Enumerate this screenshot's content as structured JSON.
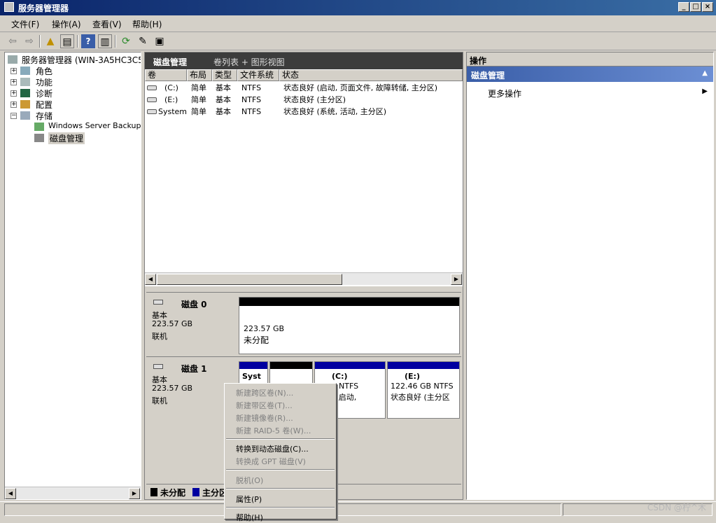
{
  "window": {
    "title": "服务器管理器"
  },
  "menu": [
    "文件(F)",
    "操作(A)",
    "查看(V)",
    "帮助(H)"
  ],
  "toolbar": {
    "icons": [
      "back-icon",
      "forward-icon",
      "up-folder-icon",
      "show-hide-tree-icon",
      "help-icon",
      "properties-icon",
      "refresh-icon",
      "export-icon",
      "rescan-icon"
    ]
  },
  "tree": {
    "root": "服务器管理器 (WIN-3A5HC3C504",
    "items": [
      "角色",
      "功能",
      "诊断",
      "配置",
      "存储"
    ],
    "storage_children": [
      "Windows Server Backup",
      "磁盘管理"
    ]
  },
  "center": {
    "title": "磁盘管理",
    "view_label": "卷列表 + 图形视图",
    "columns": [
      "卷",
      "布局",
      "类型",
      "文件系统",
      "状态"
    ],
    "volumes": [
      {
        "name": "(C:)",
        "layout": "简单",
        "type": "基本",
        "fs": "NTFS",
        "status": "状态良好 (启动, 页面文件, 故障转储, 主分区)"
      },
      {
        "name": "(E:)",
        "layout": "简单",
        "type": "基本",
        "fs": "NTFS",
        "status": "状态良好 (主分区)"
      },
      {
        "name": "System",
        "layout": "简单",
        "type": "基本",
        "fs": "NTFS",
        "status": "状态良好 (系统, 活动, 主分区)"
      }
    ],
    "disks": [
      {
        "name": "磁盘 0",
        "type": "基本",
        "size": "223.57 GB",
        "state": "联机",
        "partitions": [
          {
            "size": "223.57 GB",
            "status": "未分配"
          }
        ]
      },
      {
        "name": "磁盘 1",
        "type": "基本",
        "size": "223.57 GB",
        "state": "联机",
        "partitions": [
          {
            "label": "Syst",
            "detail": ""
          },
          {
            "label": "",
            "detail": ""
          },
          {
            "label": "(C:)",
            "detail": "1 GB NTFS",
            "status": "良好 (启动,"
          },
          {
            "label": "(E:)",
            "detail": "122.46 GB NTFS",
            "status": "状态良好 (主分区"
          }
        ]
      }
    ],
    "legend": [
      "未分配",
      "主分区"
    ]
  },
  "context_menu": {
    "items": [
      {
        "label": "新建跨区卷(N)...",
        "enabled": false
      },
      {
        "label": "新建带区卷(T)...",
        "enabled": false
      },
      {
        "label": "新建镜像卷(R)...",
        "enabled": false
      },
      {
        "label": "新建 RAID-5 卷(W)...",
        "enabled": false
      },
      {
        "label": "转换到动态磁盘(C)...",
        "enabled": true
      },
      {
        "label": "转换成 GPT 磁盘(V)",
        "enabled": false
      },
      {
        "label": "脱机(O)",
        "enabled": false
      },
      {
        "label": "属性(P)",
        "enabled": true
      },
      {
        "label": "帮助(H)",
        "enabled": true
      }
    ]
  },
  "actions": {
    "header": "操作",
    "section": "磁盘管理",
    "more": "更多操作"
  },
  "watermark": "CSDN @柠^木",
  "colors": {
    "unallocated": "#000000",
    "primary": "#0000a0",
    "section": "#3a5ea8"
  }
}
